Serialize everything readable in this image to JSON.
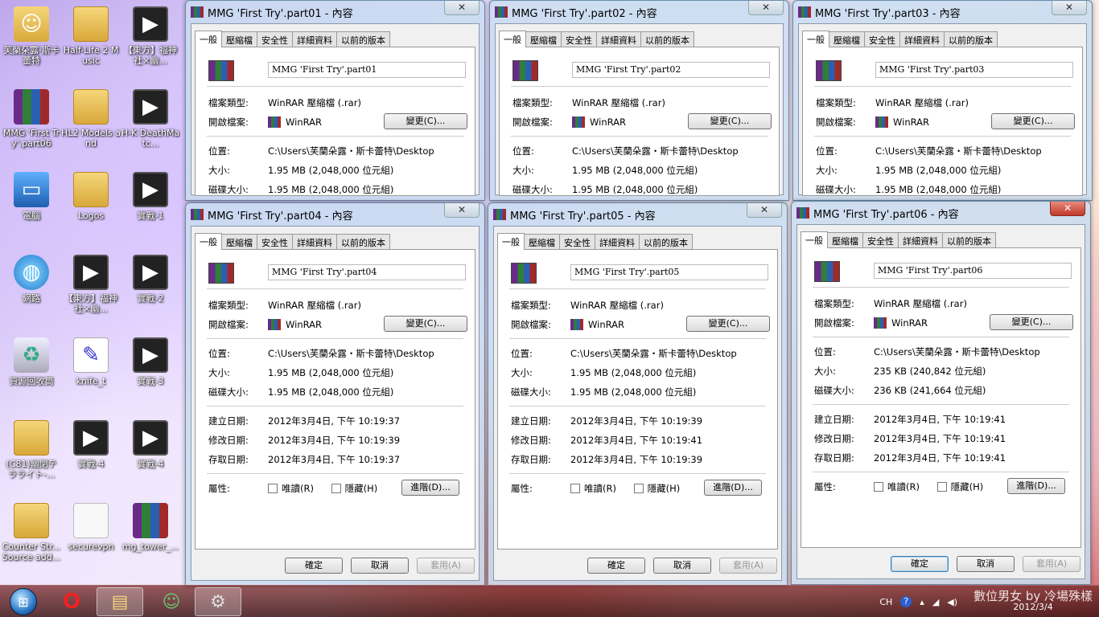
{
  "desktop_icons": [
    {
      "label": "芙蘭朵露·斯卡蕾特",
      "kind": "person",
      "col": 0,
      "row": 0
    },
    {
      "label": "Half-Life 2 Music",
      "kind": "folder",
      "col": 1,
      "row": 0
    },
    {
      "label": "【東方】福神社×幽...",
      "kind": "video",
      "col": 2,
      "row": 0
    },
    {
      "label": "MMG 'First Try'.part06",
      "kind": "rar",
      "col": 0,
      "row": 1
    },
    {
      "label": "HL2 Models and",
      "kind": "folder",
      "col": 1,
      "row": 1
    },
    {
      "label": "H-K DeathMatc...",
      "kind": "video",
      "col": 2,
      "row": 1
    },
    {
      "label": "電腦",
      "kind": "pc",
      "col": 0,
      "row": 2
    },
    {
      "label": "Logos",
      "kind": "folder",
      "col": 1,
      "row": 2
    },
    {
      "label": "實戰-1",
      "kind": "video",
      "col": 2,
      "row": 2
    },
    {
      "label": "網路",
      "kind": "globe",
      "col": 0,
      "row": 3
    },
    {
      "label": "【東方】福神社×幽...",
      "kind": "video",
      "col": 1,
      "row": 3
    },
    {
      "label": "實戰-2",
      "kind": "video",
      "col": 2,
      "row": 3
    },
    {
      "label": "資源回收筒",
      "kind": "bin",
      "col": 0,
      "row": 4
    },
    {
      "label": "knife_t",
      "kind": "doc",
      "col": 1,
      "row": 4
    },
    {
      "label": "實戰-3",
      "kind": "video",
      "col": 2,
      "row": 4
    },
    {
      "label": "(C81)幽閉テラライト-...",
      "kind": "folder",
      "col": 0,
      "row": 5
    },
    {
      "label": "實戰-4",
      "kind": "video",
      "col": 1,
      "row": 5
    },
    {
      "label": "實戰-4",
      "kind": "video",
      "col": 2,
      "row": 5
    },
    {
      "label": "Counter Str... Source add...",
      "kind": "folder",
      "col": 0,
      "row": 6
    },
    {
      "label": "securevpn",
      "kind": "file",
      "col": 1,
      "row": 6
    },
    {
      "label": "mg_tower_...",
      "kind": "rar",
      "col": 2,
      "row": 6
    }
  ],
  "tabs": [
    "一般",
    "壓縮檔",
    "安全性",
    "詳細資料",
    "以前的版本"
  ],
  "labels": {
    "type": "檔案類型:",
    "opens_with": "開啟檔案:",
    "location": "位置:",
    "size": "大小:",
    "size_on_disk": "磁碟大小:",
    "created": "建立日期:",
    "modified": "修改日期:",
    "accessed": "存取日期:",
    "attributes": "屬性:",
    "readonly": "唯讀(R)",
    "hidden": "隱藏(H)",
    "change_btn": "變更(C)...",
    "advanced_btn": "進階(D)...",
    "ok_btn": "確定",
    "cancel_btn": "取消",
    "apply_btn": "套用(A)"
  },
  "windows": [
    {
      "title": "MMG 'First Try'.part01 - 內容",
      "name": "MMG 'First Try'.part01",
      "type": "WinRAR 壓縮檔 (.rar)",
      "app": "WinRAR",
      "location": "C:\\Users\\芙蘭朵露・斯卡蕾特\\Desktop",
      "size": "1.95 MB (2,048,000 位元組)",
      "disk": "1.95 MB (2,048,000 位元組)"
    },
    {
      "title": "MMG 'First Try'.part02 - 內容",
      "name": "MMG 'First Try'.part02",
      "type": "WinRAR 壓縮檔 (.rar)",
      "app": "WinRAR",
      "location": "C:\\Users\\芙蘭朵露・斯卡蕾特\\Desktop",
      "size": "1.95 MB (2,048,000 位元組)",
      "disk": "1.95 MB (2,048,000 位元組)"
    },
    {
      "title": "MMG 'First Try'.part03 - 內容",
      "name": "MMG 'First Try'.part03",
      "type": "WinRAR 壓縮檔 (.rar)",
      "app": "WinRAR",
      "location": "C:\\Users\\芙蘭朵露・斯卡蕾特\\Desktop",
      "size": "1.95 MB (2,048,000 位元組)",
      "disk": "1.95 MB (2,048,000 位元組)"
    },
    {
      "title": "MMG 'First Try'.part04 - 內容",
      "name": "MMG 'First Try'.part04",
      "type": "WinRAR 壓縮檔 (.rar)",
      "app": "WinRAR",
      "location": "C:\\Users\\芙蘭朵露・斯卡蕾特\\Desktop",
      "size": "1.95 MB (2,048,000 位元組)",
      "disk": "1.95 MB (2,048,000 位元組)",
      "created": "2012年3月4日, 下午 10:19:37",
      "modified": "2012年3月4日, 下午 10:19:39",
      "accessed": "2012年3月4日, 下午 10:19:37"
    },
    {
      "title": "MMG 'First Try'.part05 - 內容",
      "name": "MMG 'First Try'.part05",
      "type": "WinRAR 壓縮檔 (.rar)",
      "app": "WinRAR",
      "location": "C:\\Users\\芙蘭朵露・斯卡蕾特\\Desktop",
      "size": "1.95 MB (2,048,000 位元組)",
      "disk": "1.95 MB (2,048,000 位元組)",
      "created": "2012年3月4日, 下午 10:19:39",
      "modified": "2012年3月4日, 下午 10:19:41",
      "accessed": "2012年3月4日, 下午 10:19:39"
    },
    {
      "title": "MMG 'First Try'.part06 - 內容",
      "name": "MMG 'First Try'.part06",
      "type": "WinRAR 壓縮檔 (.rar)",
      "app": "WinRAR",
      "location": "C:\\Users\\芙蘭朵露・斯卡蕾特\\Desktop",
      "size": "235 KB (240,842 位元組)",
      "disk": "236 KB (241,664 位元組)",
      "created": "2012年3月4日, 下午 10:19:41",
      "modified": "2012年3月4日, 下午 10:19:41",
      "accessed": "2012年3月4日, 下午 10:19:41"
    }
  ],
  "taskbar": {
    "apps": [
      "opera",
      "explorer",
      "messenger",
      "steam"
    ],
    "tray": {
      "lang": "CH",
      "date": "2012/3/4",
      "watermark": "數位男女 by 冷場殊樣"
    }
  }
}
